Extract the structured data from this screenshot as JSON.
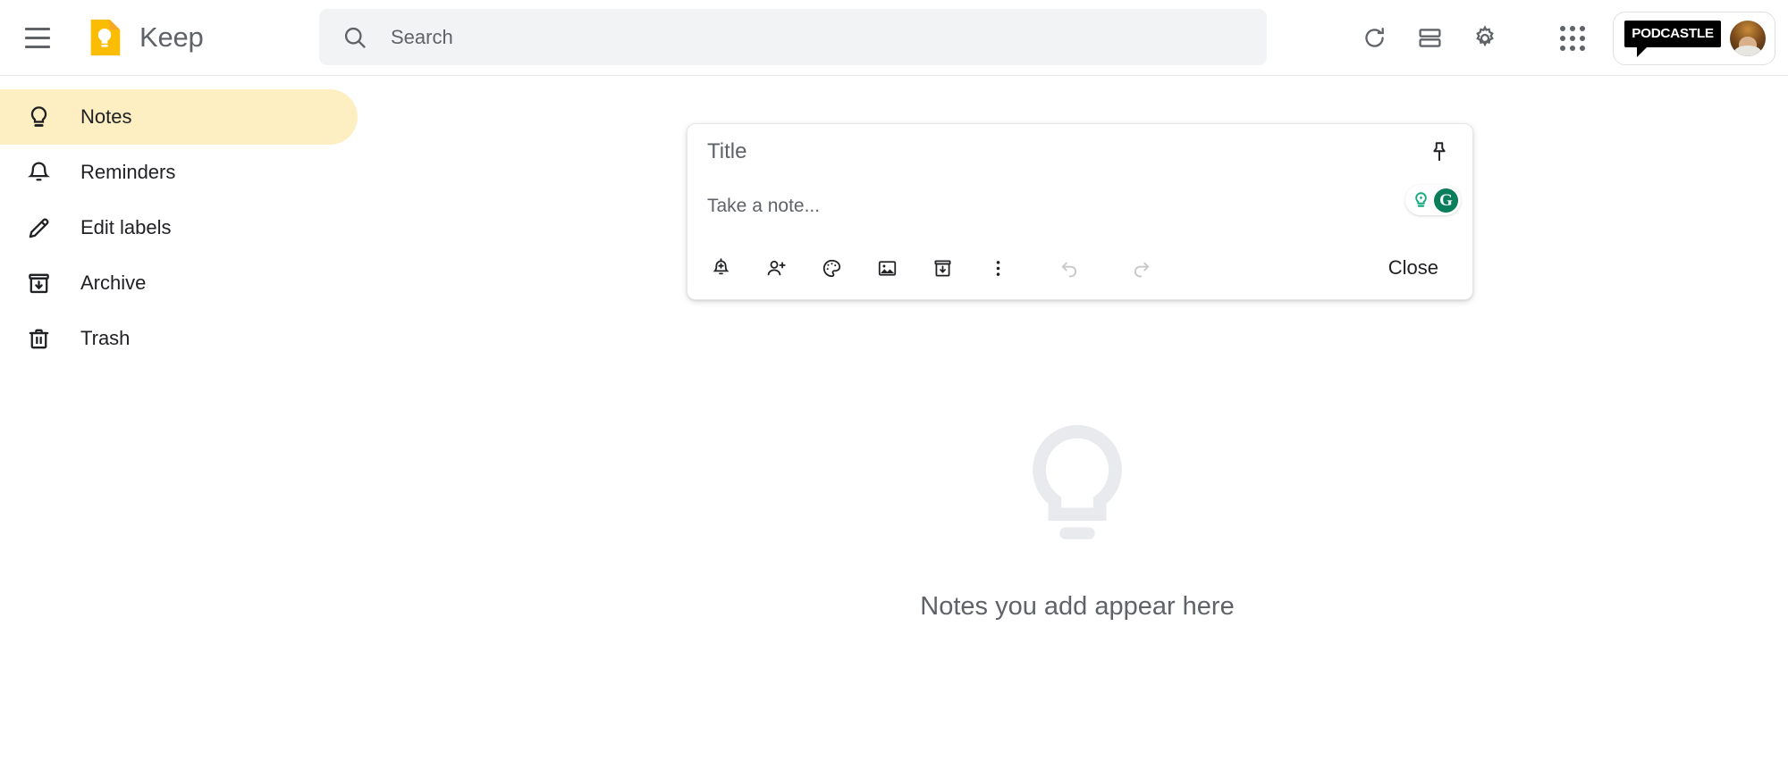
{
  "header": {
    "menu_icon": "hamburger-menu-icon",
    "logo_icon": "keep-logo-icon",
    "app_title": "Keep",
    "search": {
      "icon": "search-icon",
      "placeholder": "Search",
      "value": ""
    },
    "actions": [
      {
        "name": "refresh-button",
        "icon": "refresh-icon"
      },
      {
        "name": "list-view-button",
        "icon": "list-view-icon"
      },
      {
        "name": "settings-button",
        "icon": "gear-icon"
      },
      {
        "name": "google-apps-button",
        "icon": "apps-grid-icon"
      }
    ],
    "account": {
      "brand_label": "PODCASTLE",
      "avatar_icon": "user-avatar"
    }
  },
  "sidebar": {
    "items": [
      {
        "label": "Notes",
        "icon": "lightbulb-icon",
        "active": true
      },
      {
        "label": "Reminders",
        "icon": "bell-icon",
        "active": false
      },
      {
        "label": "Edit labels",
        "icon": "pencil-icon",
        "active": false
      },
      {
        "label": "Archive",
        "icon": "archive-icon",
        "active": false
      },
      {
        "label": "Trash",
        "icon": "trash-icon",
        "active": false
      }
    ]
  },
  "composer": {
    "title_placeholder": "Title",
    "title_value": "",
    "body_placeholder": "Take a note...",
    "body_value": "",
    "pin_icon": "pin-icon",
    "grammarly": {
      "bulb_icon": "grammarly-bulb-icon",
      "letter": "G"
    },
    "tools": [
      {
        "name": "remind-me-button",
        "icon": "bell-plus-icon",
        "disabled": false
      },
      {
        "name": "collaborator-button",
        "icon": "person-plus-icon",
        "disabled": false
      },
      {
        "name": "background-options-button",
        "icon": "palette-icon",
        "disabled": false
      },
      {
        "name": "add-image-button",
        "icon": "image-icon",
        "disabled": false
      },
      {
        "name": "archive-button",
        "icon": "archive-icon",
        "disabled": false
      },
      {
        "name": "more-options-button",
        "icon": "three-dots-vertical-icon",
        "disabled": false
      },
      {
        "name": "undo-button",
        "icon": "undo-icon",
        "disabled": true
      },
      {
        "name": "redo-button",
        "icon": "redo-icon",
        "disabled": true
      }
    ],
    "close_label": "Close"
  },
  "empty_state": {
    "icon": "lightbulb-large-icon",
    "text": "Notes you add appear here"
  },
  "colors": {
    "keep_yellow": "#fbbc04",
    "active_nav": "#feefc3",
    "search_bg": "#f1f3f4",
    "icon_grey": "#5f6368",
    "text_dark": "#202124",
    "empty_grey": "#e8eaed",
    "grammarly_green": "#0a7d5a",
    "grammarly_teal": "#15a97c"
  }
}
